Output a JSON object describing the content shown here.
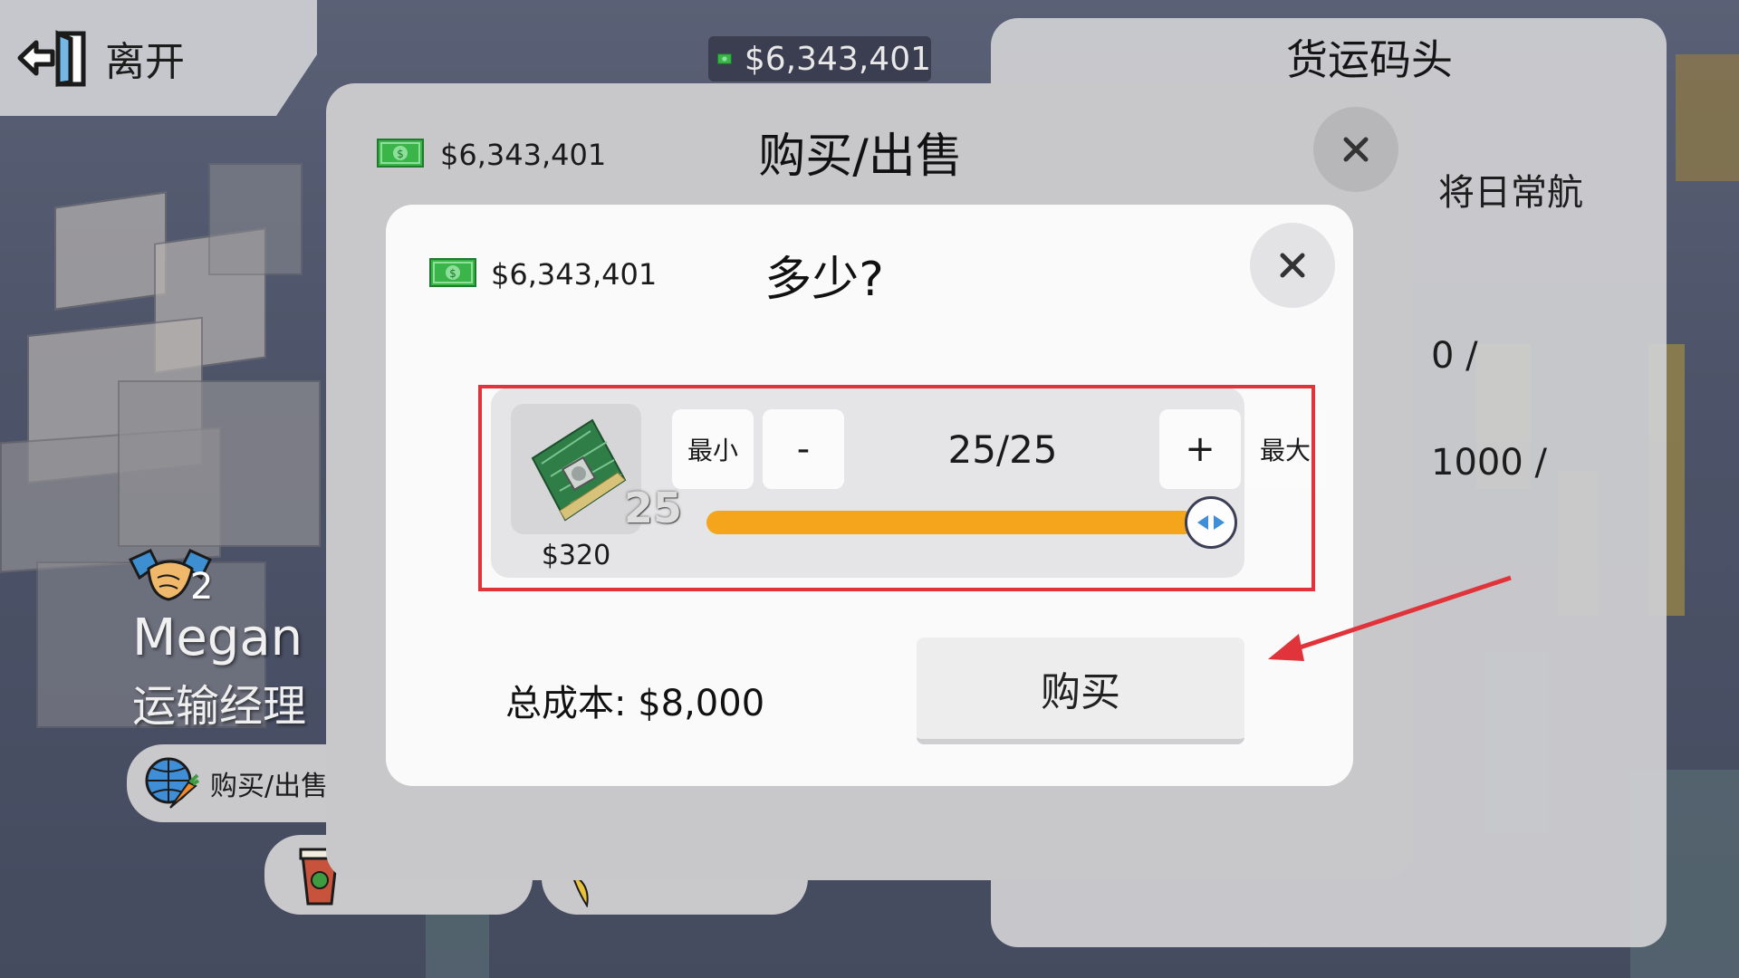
{
  "exit": {
    "label": "离开"
  },
  "top_balance": "$6,343,401",
  "right_panel": {
    "title": "货运码头",
    "line1": "将日常航",
    "line2": "：0 /",
    "line3": "：1000 /"
  },
  "npc": {
    "handshake_count": "2",
    "name": "Megan",
    "role": "运输经理",
    "buysell_label": "购买/出售"
  },
  "outer_modal": {
    "balance": "$6,343,401",
    "title": "购买/出售"
  },
  "inner_modal": {
    "balance": "$6,343,401",
    "title": "多少?",
    "item": {
      "count": "25",
      "price": "$320"
    },
    "min_label": "最小",
    "minus_label": "-",
    "quantity": "25/25",
    "plus_label": "+",
    "max_label": "最大",
    "slider_fraction": 1.0,
    "total": "总成本: $8,000",
    "buy_label": "购买"
  },
  "colors": {
    "slider": "#f4a51c",
    "highlight": "#e0343a",
    "arrow": "#e0343a"
  }
}
